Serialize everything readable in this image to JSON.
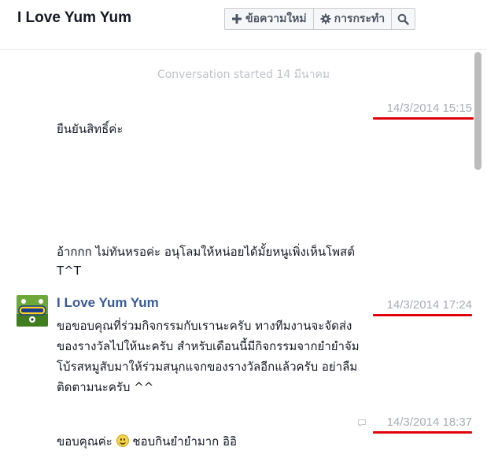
{
  "header": {
    "title": "I Love Yum Yum",
    "new_message_label": "ข้อความใหม่",
    "actions_label": "การกระทำ"
  },
  "conversation": {
    "started_text": "Conversation started 14 มีนาคม",
    "messages": [
      {
        "timestamp": "14/3/2014 15:15",
        "lines": [
          "ยืนยันสิทธิ์ค่ะ"
        ]
      },
      {
        "lines": [
          "อ้ากกก ไม่ทันหรอค่ะ อนุโลมให้หน่อยได้มั้ยหนูเพิ่งเห็นโพสต์",
          "T^T"
        ]
      },
      {
        "sender": "I Love Yum Yum",
        "timestamp": "14/3/2014 17:24",
        "lines": [
          "ขอขอบคุณที่ร่วมกิจกรรมกับเรานะครับ ทางทีมงานจะจัดส่ง",
          "ของรางวัลไปให้นะครับ สำหรับเดือนนี้มีกิจกรรมจากยำยำจัม",
          "โบ้รสหมูสับมาให้ร่วมสนุกแจกของรางวัลอีกแล้วครับ อย่าลืม",
          "ติดตามนะครับ ^^"
        ]
      },
      {
        "timestamp": "14/3/2014 18:37",
        "text_before_emoji": "ขอบคุณค่ะ",
        "text_after_emoji": "ชอบกินยำยำมาก อิอิ"
      }
    ]
  },
  "avatar_caption": "ป้ายยำยำ",
  "colors": {
    "accent_underline": "#e0000a",
    "sender_name": "#3b5998",
    "timestamp": "#a8adb5"
  }
}
